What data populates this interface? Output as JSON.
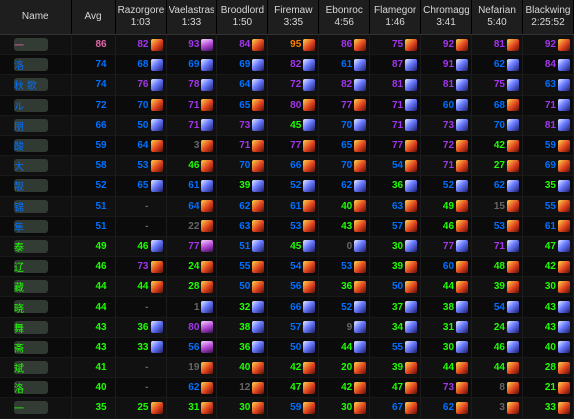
{
  "colors": {
    "orange": "#ff8000",
    "purple": "#a335ee",
    "blue": "#0070ff",
    "green": "#1eff00",
    "gray": "#666666",
    "pink": "#e268a8"
  },
  "header": {
    "name_label": "Name",
    "avg_label": "Avg",
    "bosses": [
      {
        "name": "Razorgore",
        "time": "1:03"
      },
      {
        "name": "Vaelastrasz",
        "time": "1:33"
      },
      {
        "name": "Broodlord",
        "time": "1:50"
      },
      {
        "name": "Firemaw",
        "time": "3:35"
      },
      {
        "name": "Ebonroc",
        "time": "4:56"
      },
      {
        "name": "Flamegor",
        "time": "1:46"
      },
      {
        "name": "Chromaggus",
        "time": "3:41"
      },
      {
        "name": "Nefarian",
        "time": "5:40"
      },
      {
        "name": "Blackwing",
        "time": "2:25:52"
      }
    ]
  },
  "rows": [
    {
      "name": "一",
      "avg": "86",
      "avg_c": "pink",
      "cells": [
        [
          "82",
          "purple",
          "fire"
        ],
        [
          "93",
          "purple",
          "arcane"
        ],
        [
          "84",
          "purple",
          "fire"
        ],
        [
          "95",
          "orange",
          "fire"
        ],
        [
          "86",
          "purple",
          "fire"
        ],
        [
          "75",
          "purple",
          "fire"
        ],
        [
          "92",
          "purple",
          "fire"
        ],
        [
          "81",
          "purple",
          "fire"
        ],
        [
          "92",
          "purple",
          "fire"
        ]
      ]
    },
    {
      "name": "洛",
      "avg": "74",
      "avg_c": "blue",
      "cells": [
        [
          "68",
          "blue",
          "frost"
        ],
        [
          "69",
          "blue",
          "frost"
        ],
        [
          "69",
          "blue",
          "frost"
        ],
        [
          "82",
          "purple",
          "frost"
        ],
        [
          "61",
          "blue",
          "frost"
        ],
        [
          "87",
          "purple",
          "frost"
        ],
        [
          "91",
          "purple",
          "frost"
        ],
        [
          "62",
          "blue",
          "frost"
        ],
        [
          "84",
          "purple",
          "frost"
        ]
      ]
    },
    {
      "name": "秋 歌",
      "avg": "74",
      "avg_c": "blue",
      "cells": [
        [
          "76",
          "purple",
          "frost"
        ],
        [
          "78",
          "purple",
          "frost"
        ],
        [
          "64",
          "blue",
          "frost"
        ],
        [
          "72",
          "purple",
          "frost"
        ],
        [
          "82",
          "purple",
          "frost"
        ],
        [
          "81",
          "purple",
          "frost"
        ],
        [
          "81",
          "purple",
          "frost"
        ],
        [
          "75",
          "purple",
          "frost"
        ],
        [
          "63",
          "blue",
          "frost"
        ]
      ]
    },
    {
      "name": "ル",
      "avg": "72",
      "avg_c": "blue",
      "cells": [
        [
          "70",
          "blue",
          "fire"
        ],
        [
          "71",
          "purple",
          "fire"
        ],
        [
          "65",
          "blue",
          "fire"
        ],
        [
          "80",
          "purple",
          "fire"
        ],
        [
          "77",
          "purple",
          "fire"
        ],
        [
          "71",
          "purple",
          "frost"
        ],
        [
          "60",
          "blue",
          "frost"
        ],
        [
          "68",
          "blue",
          "fire"
        ],
        [
          "71",
          "purple",
          "frost"
        ]
      ]
    },
    {
      "name": "朋",
      "avg": "66",
      "avg_c": "blue",
      "cells": [
        [
          "50",
          "blue",
          "frost"
        ],
        [
          "71",
          "purple",
          "frost"
        ],
        [
          "73",
          "purple",
          "frost"
        ],
        [
          "45",
          "green",
          "frost"
        ],
        [
          "70",
          "blue",
          "frost"
        ],
        [
          "71",
          "purple",
          "frost"
        ],
        [
          "73",
          "purple",
          "frost"
        ],
        [
          "70",
          "blue",
          "frost"
        ],
        [
          "81",
          "purple",
          "frost"
        ]
      ]
    },
    {
      "name": "酸",
      "avg": "59",
      "avg_c": "blue",
      "cells": [
        [
          "64",
          "blue",
          "fire"
        ],
        [
          "3",
          "gray",
          "fire"
        ],
        [
          "71",
          "purple",
          "fire"
        ],
        [
          "77",
          "purple",
          "fire"
        ],
        [
          "65",
          "blue",
          "fire"
        ],
        [
          "77",
          "purple",
          "fire"
        ],
        [
          "72",
          "purple",
          "fire"
        ],
        [
          "42",
          "green",
          "fire"
        ],
        [
          "59",
          "blue",
          "fire"
        ]
      ]
    },
    {
      "name": "大",
      "avg": "58",
      "avg_c": "blue",
      "cells": [
        [
          "53",
          "blue",
          "fire"
        ],
        [
          "46",
          "green",
          "fire"
        ],
        [
          "70",
          "blue",
          "fire"
        ],
        [
          "66",
          "blue",
          "fire"
        ],
        [
          "70",
          "blue",
          "fire"
        ],
        [
          "54",
          "blue",
          "fire"
        ],
        [
          "71",
          "purple",
          "fire"
        ],
        [
          "27",
          "green",
          "fire"
        ],
        [
          "69",
          "blue",
          "fire"
        ]
      ]
    },
    {
      "name": "靓",
      "avg": "52",
      "avg_c": "blue",
      "cells": [
        [
          "65",
          "blue",
          "frost"
        ],
        [
          "61",
          "blue",
          "frost"
        ],
        [
          "39",
          "green",
          "frost"
        ],
        [
          "52",
          "blue",
          "frost"
        ],
        [
          "62",
          "blue",
          "frost"
        ],
        [
          "36",
          "green",
          "frost"
        ],
        [
          "52",
          "blue",
          "frost"
        ],
        [
          "62",
          "blue",
          "frost"
        ],
        [
          "35",
          "green",
          "frost"
        ]
      ]
    },
    {
      "name": "锦",
      "avg": "51",
      "avg_c": "blue",
      "cells": [
        [
          "-",
          "gray",
          "empty"
        ],
        [
          "64",
          "blue",
          "fire"
        ],
        [
          "62",
          "blue",
          "fire"
        ],
        [
          "61",
          "blue",
          "fire"
        ],
        [
          "40",
          "green",
          "fire"
        ],
        [
          "63",
          "blue",
          "fire"
        ],
        [
          "49",
          "green",
          "fire"
        ],
        [
          "15",
          "gray",
          "fire"
        ],
        [
          "55",
          "blue",
          "fire"
        ]
      ]
    },
    {
      "name": "隼",
      "avg": "51",
      "avg_c": "blue",
      "cells": [
        [
          "-",
          "gray",
          "empty"
        ],
        [
          "22",
          "gray",
          "fire"
        ],
        [
          "63",
          "blue",
          "fire"
        ],
        [
          "53",
          "blue",
          "fire"
        ],
        [
          "43",
          "green",
          "fire"
        ],
        [
          "57",
          "blue",
          "fire"
        ],
        [
          "46",
          "green",
          "fire"
        ],
        [
          "53",
          "blue",
          "fire"
        ],
        [
          "61",
          "blue",
          "fire"
        ]
      ]
    },
    {
      "name": "泰",
      "avg": "49",
      "avg_c": "green",
      "cells": [
        [
          "46",
          "green",
          "frost"
        ],
        [
          "77",
          "purple",
          "arcane"
        ],
        [
          "51",
          "blue",
          "frost"
        ],
        [
          "45",
          "green",
          "frost"
        ],
        [
          "0",
          "gray",
          "frost"
        ],
        [
          "30",
          "green",
          "frost"
        ],
        [
          "77",
          "purple",
          "frost"
        ],
        [
          "71",
          "purple",
          "frost"
        ],
        [
          "47",
          "green",
          "frost"
        ]
      ]
    },
    {
      "name": "辽",
      "avg": "46",
      "avg_c": "green",
      "cells": [
        [
          "73",
          "purple",
          "fire"
        ],
        [
          "24",
          "green",
          "fire"
        ],
        [
          "55",
          "blue",
          "fire"
        ],
        [
          "54",
          "blue",
          "fire"
        ],
        [
          "53",
          "blue",
          "fire"
        ],
        [
          "39",
          "green",
          "fire"
        ],
        [
          "60",
          "blue",
          "fire"
        ],
        [
          "48",
          "green",
          "fire"
        ],
        [
          "42",
          "green",
          "fire"
        ]
      ]
    },
    {
      "name": "藏",
      "avg": "44",
      "avg_c": "green",
      "cells": [
        [
          "44",
          "green",
          "fire"
        ],
        [
          "28",
          "green",
          "fire"
        ],
        [
          "50",
          "blue",
          "fire"
        ],
        [
          "56",
          "blue",
          "fire"
        ],
        [
          "36",
          "green",
          "fire"
        ],
        [
          "50",
          "blue",
          "fire"
        ],
        [
          "44",
          "green",
          "fire"
        ],
        [
          "39",
          "green",
          "fire"
        ],
        [
          "30",
          "green",
          "fire"
        ]
      ]
    },
    {
      "name": "晓",
      "avg": "44",
      "avg_c": "green",
      "cells": [
        [
          "-",
          "gray",
          "empty"
        ],
        [
          "1",
          "gray",
          "frost"
        ],
        [
          "32",
          "green",
          "frost"
        ],
        [
          "66",
          "blue",
          "frost"
        ],
        [
          "52",
          "blue",
          "frost"
        ],
        [
          "37",
          "green",
          "frost"
        ],
        [
          "38",
          "green",
          "frost"
        ],
        [
          "54",
          "blue",
          "frost"
        ],
        [
          "43",
          "green",
          "frost"
        ]
      ]
    },
    {
      "name": "舞",
      "avg": "43",
      "avg_c": "green",
      "cells": [
        [
          "36",
          "green",
          "frost"
        ],
        [
          "80",
          "purple",
          "arcane"
        ],
        [
          "38",
          "green",
          "frost"
        ],
        [
          "57",
          "blue",
          "frost"
        ],
        [
          "9",
          "gray",
          "frost"
        ],
        [
          "34",
          "green",
          "frost"
        ],
        [
          "31",
          "green",
          "frost"
        ],
        [
          "24",
          "green",
          "frost"
        ],
        [
          "43",
          "green",
          "frost"
        ]
      ]
    },
    {
      "name": "斋",
      "avg": "43",
      "avg_c": "green",
      "cells": [
        [
          "33",
          "green",
          "frost"
        ],
        [
          "56",
          "blue",
          "arcane"
        ],
        [
          "36",
          "green",
          "frost"
        ],
        [
          "50",
          "blue",
          "frost"
        ],
        [
          "44",
          "green",
          "frost"
        ],
        [
          "55",
          "blue",
          "frost"
        ],
        [
          "30",
          "green",
          "frost"
        ],
        [
          "46",
          "green",
          "frost"
        ],
        [
          "40",
          "green",
          "frost"
        ]
      ]
    },
    {
      "name": "斌",
      "avg": "41",
      "avg_c": "green",
      "cells": [
        [
          "-",
          "gray",
          "empty"
        ],
        [
          "19",
          "gray",
          "fire"
        ],
        [
          "40",
          "green",
          "fire"
        ],
        [
          "42",
          "green",
          "fire"
        ],
        [
          "20",
          "green",
          "fire"
        ],
        [
          "39",
          "green",
          "fire"
        ],
        [
          "44",
          "green",
          "fire"
        ],
        [
          "44",
          "green",
          "fire"
        ],
        [
          "28",
          "green",
          "fire"
        ]
      ]
    },
    {
      "name": "洛",
      "avg": "40",
      "avg_c": "green",
      "cells": [
        [
          "-",
          "gray",
          "empty"
        ],
        [
          "62",
          "blue",
          "fire"
        ],
        [
          "12",
          "gray",
          "fire"
        ],
        [
          "47",
          "green",
          "fire"
        ],
        [
          "42",
          "green",
          "fire"
        ],
        [
          "47",
          "green",
          "fire"
        ],
        [
          "73",
          "purple",
          "fire"
        ],
        [
          "8",
          "gray",
          "fire"
        ],
        [
          "21",
          "green",
          "fire"
        ]
      ]
    },
    {
      "name": "一",
      "avg": "35",
      "avg_c": "green",
      "cells": [
        [
          "25",
          "green",
          "fire"
        ],
        [
          "31",
          "green",
          "fire"
        ],
        [
          "30",
          "green",
          "fire"
        ],
        [
          "59",
          "blue",
          "fire"
        ],
        [
          "30",
          "green",
          "fire"
        ],
        [
          "67",
          "blue",
          "fire"
        ],
        [
          "62",
          "blue",
          "fire"
        ],
        [
          "3",
          "gray",
          "fire"
        ],
        [
          "33",
          "green",
          "fire"
        ]
      ]
    }
  ]
}
